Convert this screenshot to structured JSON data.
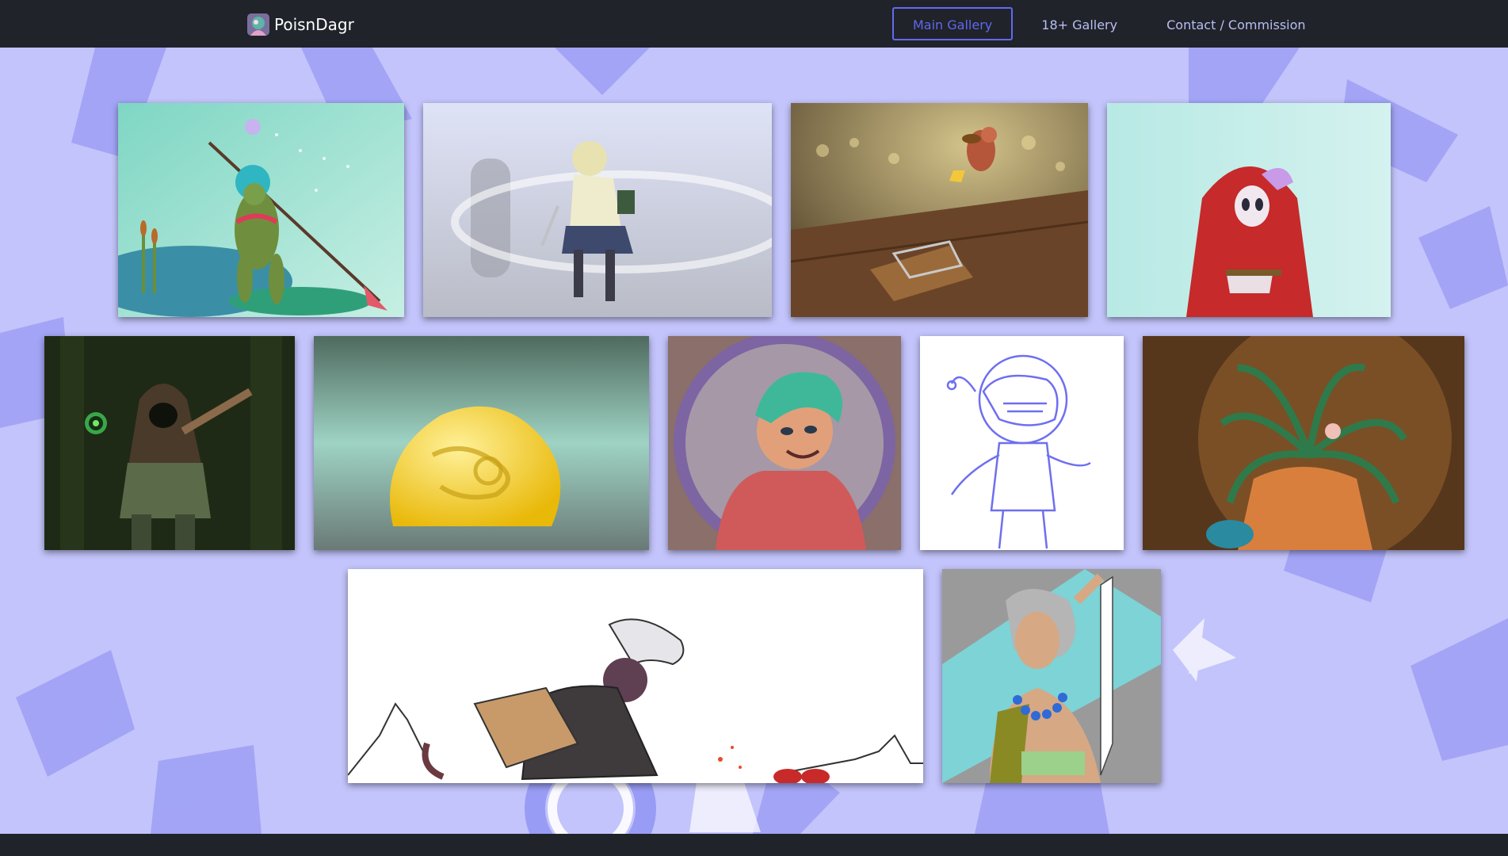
{
  "brand": {
    "name": "PoisnDagr",
    "logo_icon": "artist-avatar-icon"
  },
  "nav": {
    "items": [
      {
        "label": "Main Gallery",
        "active": true
      },
      {
        "label": "18+ Gallery",
        "active": false
      },
      {
        "label": "Contact / Commission",
        "active": false
      }
    ]
  },
  "colors": {
    "navbar_bg": "#202329",
    "page_bg": "#c3c4fb",
    "nav_active": "#6169ef",
    "nav_link": "#b9bef5"
  },
  "gallery": {
    "rows": [
      [
        "goblin-spear-swamp-art",
        "schoolgirl-knife-swing-art",
        "mouse-cheese-mousetrap-art",
        "hooded-mask-girl-art"
      ],
      [
        "hooded-forest-druid-art",
        "yellow-slime-blob-art",
        "green-hair-boy-bubble-art",
        "astronaut-anglerfish-sketch-art",
        "fern-plant-creature-art"
      ],
      [
        "horned-warrior-lineart-art",
        "beaded-necklace-woman-art"
      ]
    ]
  }
}
